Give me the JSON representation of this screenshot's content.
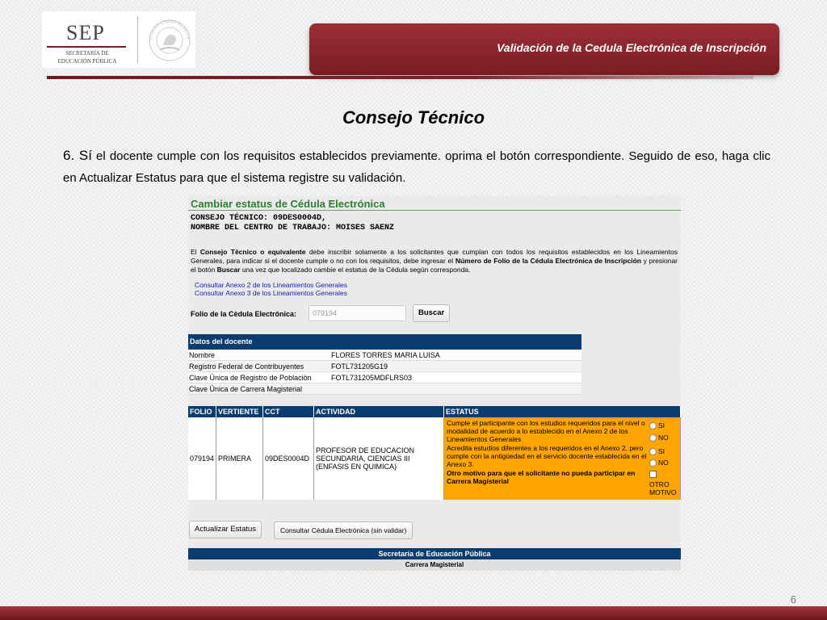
{
  "header": {
    "logo_text": "SEP",
    "logo_subtitle": "SECRETARÍA DE EDUCACIÓN PÚBLICA",
    "seal_text": "ESTADOS UNIDOS MEXICANOS",
    "title": "Validación de la Cedula Electrónica de Inscripción",
    "brand_color": "#7a1c22"
  },
  "slide": {
    "heading": "Consejo Técnico",
    "instr_num": "6. Sí",
    "instr_rest": " el docente cumple con los requisitos establecidos previamente. oprima el botón correspondiente. Seguido de eso, haga clic en Actualizar Estatus para que el sistema registre su validación.",
    "page_number": "6"
  },
  "screen": {
    "title": "Cambiar estatus de Cédula Electrónica",
    "consejo_line": "CONSEJO TÉCNICO: 09DES0004D,",
    "centro_line": "NOMBRE DEL CENTRO DE TRABAJO: MOISES SAENZ",
    "desc": {
      "p1": "El ",
      "b1": "Consejo Tècnico o equivalente",
      "p2": " debe inscribir solamente a los solicitantes que cumplan con todos los requisitos establecidos en los Lineamientos Generales, para indicar si el docente cumple o no con los requisitos, debe ingresar el ",
      "b2": "Número de Folio de la Cédula Electrónica de Inscripción",
      "p3": " y presionar el botón ",
      "b3": "Buscar",
      "p4": " una vez que localizado cambie el estatus de la Cédula según corresponda."
    },
    "links": [
      "Consultar Anexo 2 de los Lineamientos Generales",
      "Consultar Anexo 3 de los Lineamientos Generales"
    ],
    "folio_label": "Folio de la Cèdula Electrónica:",
    "folio_value": "079194",
    "search_button": "Buscar",
    "datos": {
      "title": "Datos del docente",
      "rows": [
        {
          "k": "Nombre",
          "v": "FLORES TORRES MARIA LUISA"
        },
        {
          "k": "Registro Federal de Contribuyentes",
          "v": "FOTL731205G19"
        },
        {
          "k": "Clave Única de Registro de Poblaciòn",
          "v": "FOTL731205MDFLRS03"
        },
        {
          "k": "Clave Única de Carrera Magisterial",
          "v": ""
        }
      ]
    },
    "grid": {
      "headers": [
        "FOLIO",
        "VERTIENTE",
        "CCT",
        "ACTIVIDAD",
        "ESTATUS"
      ],
      "row": {
        "folio": "079194",
        "vertiente": "PRIMERA",
        "cct": "09DES0004D",
        "actividad": "PROFESOR DE EDUCACION SECUNDARIA, CIENCIAS III (ENFASIS EN QUIMICA)"
      },
      "status_text_1": "Cumple el participante con los estudios requeridos para el nivel o modalidad de acuerdo a lo establecido en el Anexo 2 de los Lineamientos Generales",
      "status_text_2": "Acredita estudios diferentes a los requeridos en el Anexo 2, pero cumple con la antigüedad en el servicio docente establecida en el Anexo 3.",
      "status_text_3": "Otro motivo para que el solicitante no pueda participar en Carrera Magisterial",
      "opt_si": "SI",
      "opt_no": "NO",
      "opt_otro_1": "OTRO",
      "opt_otro_2": "MOTIVO",
      "status_color": "#ffa500"
    },
    "update_button": "Actualizar Estatus",
    "consult_button": "Consultar Cédula Electrónica (sin validar)",
    "footer_1": "Secretaría de Educación Pública",
    "footer_2": "Carrera Magisterial"
  }
}
